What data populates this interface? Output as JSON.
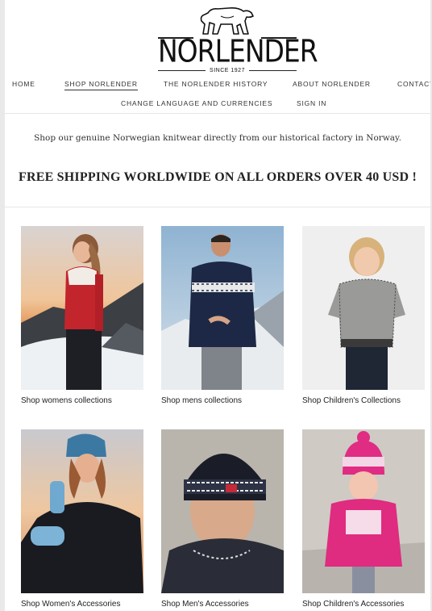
{
  "brand": {
    "name": "NORLENDER",
    "since": "SINCE 1927"
  },
  "nav": {
    "home": "HOME",
    "shop": "SHOP NORLENDER",
    "history": "THE NORLENDER HISTORY",
    "about": "ABOUT NORLENDER",
    "contact": "CONTACT",
    "language": "CHANGE LANGUAGE AND CURRENCIES",
    "signin": "SIGN IN"
  },
  "tagline": "Shop our genuine Norwegian knitwear directly from our historical factory in Norway.",
  "shipping": "FREE SHIPPING WORLDWIDE ON ALL ORDERS OVER 40 USD !",
  "collections": [
    {
      "label": "Shop womens collections"
    },
    {
      "label": "Shop mens collections"
    },
    {
      "label": "Shop Children's Collections"
    },
    {
      "label": "Shop Women's Accessories"
    },
    {
      "label": "Shop Men's Accessories"
    },
    {
      "label": "Shop Children's Accessories"
    }
  ]
}
